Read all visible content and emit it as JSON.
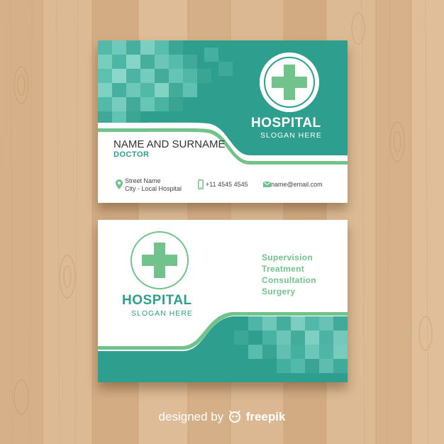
{
  "front": {
    "logo_title": "HOSPITAL",
    "logo_slogan": "SLOGAN HERE",
    "name": "NAME AND SURNAME",
    "role": "DOCTOR",
    "address_line1": "Street Name",
    "address_line2": "City - Local Hospital",
    "phone": "+11 4545 4545",
    "email": "name@email.com"
  },
  "back": {
    "logo_title": "HOSPITAL",
    "logo_slogan": "SLOGAN HERE",
    "services": [
      "Supervision",
      "Treatment",
      "Consultation",
      "Surgery"
    ]
  },
  "credit": {
    "prefix": "designed by",
    "brand": "freepik"
  },
  "colors": {
    "teal": "#2e9e8f",
    "light_teal": "#64c7b7",
    "green": "#72c28b",
    "wood": "#d9b58f"
  },
  "icons": [
    "medical-cross-icon",
    "location-pin-icon",
    "phone-icon",
    "mail-icon",
    "freepik-logo-icon"
  ]
}
